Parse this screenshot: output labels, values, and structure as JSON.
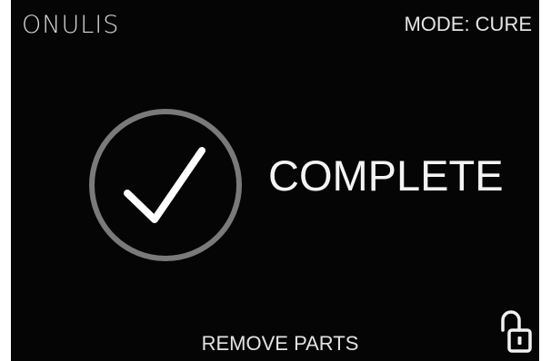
{
  "header": {
    "brand": "ONULIS",
    "mode": "MODE: CURE"
  },
  "status": {
    "label": "COMPLETE",
    "icon": "checkmark-circle-icon"
  },
  "footer": {
    "instruction": "REMOVE PARTS",
    "lock_icon": "unlocked-padlock-icon"
  },
  "colors": {
    "background": "#050505",
    "text": "#f4f4f4",
    "ring": "#7a7a7a",
    "check": "#ffffff"
  }
}
